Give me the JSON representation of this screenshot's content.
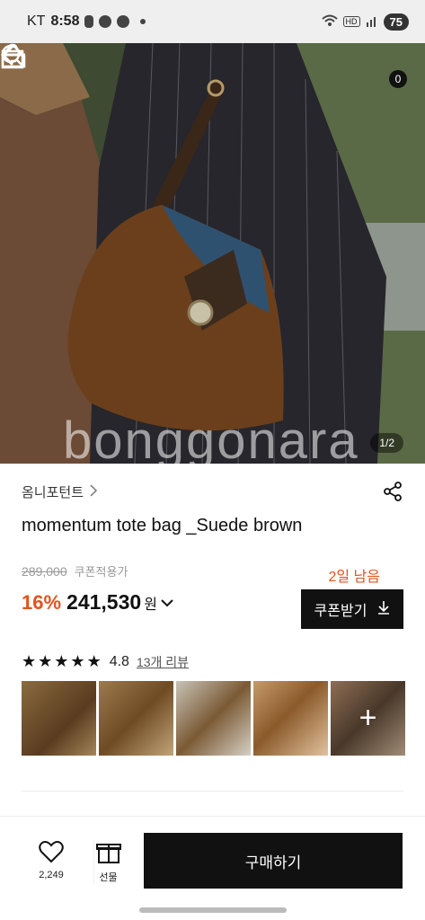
{
  "status_bar": {
    "carrier": "KT",
    "time": "8:58",
    "battery": "75"
  },
  "hero": {
    "page_indicator": "1/2",
    "cart_count": "0",
    "watermark": "bonggonara",
    "icons": [
      "back-arrow-icon",
      "home-icon",
      "search-icon",
      "cart-icon"
    ]
  },
  "product": {
    "brand": "옴니포턴트",
    "title": "momentum tote bag _Suede brown",
    "original_price": "289,000",
    "coupon_price_label": "쿠폰적용가",
    "days_left": "2일 남음",
    "discount": "16%",
    "sale_price": "241,530",
    "currency": "원",
    "coupon_button": "쿠폰받기",
    "rating": "4.8",
    "review_link": "13개 리뷰",
    "star_count": 5,
    "accent_color": "#e0541f"
  },
  "bottom_bar": {
    "like_count": "2,249",
    "gift_label": "선물",
    "buy_button": "구매하기"
  }
}
